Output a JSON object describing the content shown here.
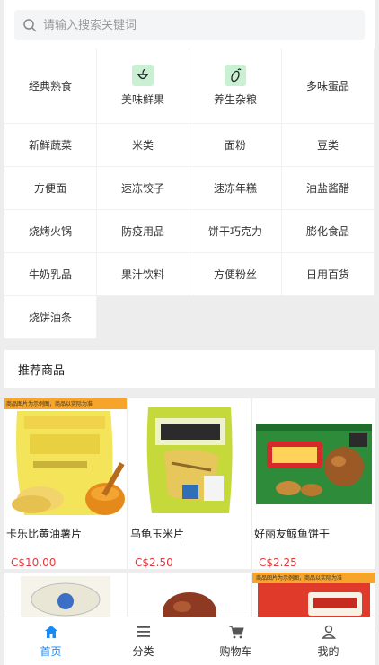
{
  "search": {
    "placeholder": "请输入搜索关键词"
  },
  "categories": [
    {
      "label": "经典熟食"
    },
    {
      "label": "美味鲜果",
      "icon": "fruit-icon"
    },
    {
      "label": "养生杂粮",
      "icon": "grain-icon"
    },
    {
      "label": "多味蛋品"
    },
    {
      "label": "新鲜蔬菜"
    },
    {
      "label": "米类"
    },
    {
      "label": "面粉"
    },
    {
      "label": "豆类"
    },
    {
      "label": "方便面"
    },
    {
      "label": "速冻饺子"
    },
    {
      "label": "速冻年糕"
    },
    {
      "label": "油盐酱醋"
    },
    {
      "label": "烧烤火锅"
    },
    {
      "label": "防疫用品"
    },
    {
      "label": "饼干巧克力"
    },
    {
      "label": "膨化食品"
    },
    {
      "label": "牛奶乳品"
    },
    {
      "label": "果汁饮料"
    },
    {
      "label": "方便粉丝"
    },
    {
      "label": "日用百货"
    },
    {
      "label": "烧饼油条"
    }
  ],
  "recommend": {
    "title": "推荐商品"
  },
  "products": [
    {
      "name": "卡乐比黄油薯片",
      "price": "C$10.00",
      "banner": "商品图片为示例图，商品以实际为准"
    },
    {
      "name": "乌龟玉米片",
      "price": "C$2.50"
    },
    {
      "name": "好丽友鲸鱼饼干",
      "price": "C$2.25"
    },
    {
      "name": "",
      "price": ""
    },
    {
      "name": "",
      "price": ""
    },
    {
      "name": "",
      "price": "",
      "banner": "商品图片为示例图，商品以实际为准"
    }
  ],
  "tabs": [
    {
      "label": "首页",
      "icon": "home-icon",
      "active": true
    },
    {
      "label": "分类",
      "icon": "menu-icon"
    },
    {
      "label": "购物车",
      "icon": "cart-icon"
    },
    {
      "label": "我的",
      "icon": "user-icon"
    }
  ],
  "colors": {
    "accent": "#1989fa",
    "price": "#e4393c",
    "background": "#ededed"
  }
}
